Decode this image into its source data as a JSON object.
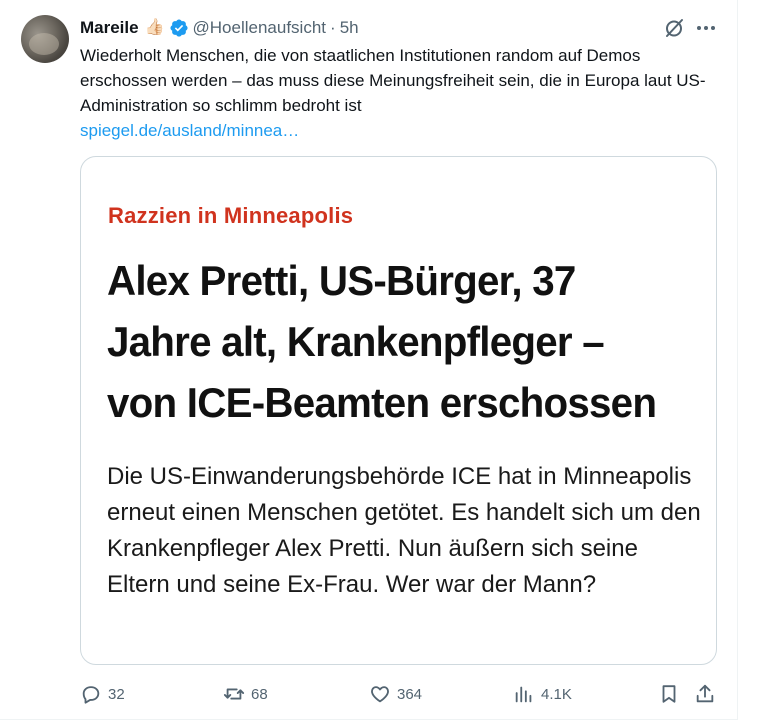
{
  "tweet": {
    "author_name": "Mareile",
    "author_emoji": "👍🏻",
    "handle": "@Hoellenaufsicht",
    "separator": "·",
    "time": "5h",
    "text": "Wiederholt Menschen, die von staatlichen Institutionen random auf Demos erschossen werden – das muss diese Meinungsfreiheit sein, die in Europa laut US-Administration so schlimm bedroht ist",
    "link": "spiegel.de/ausland/minnea…"
  },
  "card": {
    "kicker": "Razzien in Minneapolis",
    "headline": "Alex Pretti, US-Bürger, 37 Jahre alt, Krankenpfleger – von ICE-Beamten erschossen",
    "teaser": "Die US-Einwanderungsbehörde ICE hat in Minneapolis erneut einen Menschen getötet. Es handelt sich um den Krankenpfleger Alex Pretti. Nun äußern sich seine Eltern und seine Ex-Frau. Wer war der Mann?"
  },
  "actions": {
    "replies": "32",
    "reposts": "68",
    "likes": "364",
    "views": "4.1K"
  },
  "icons": {
    "verified": "verified-badge-icon",
    "grok": "grok-icon",
    "more": "more-dots-icon",
    "reply": "reply-icon",
    "repost": "repost-icon",
    "like": "heart-icon",
    "views": "views-chart-icon",
    "bookmark": "bookmark-icon",
    "share": "share-icon"
  },
  "colors": {
    "text": "#0f1419",
    "secondary": "#536471",
    "link": "#1d9bf0",
    "verified": "#1d9bf0",
    "kicker": "#d0331e"
  }
}
